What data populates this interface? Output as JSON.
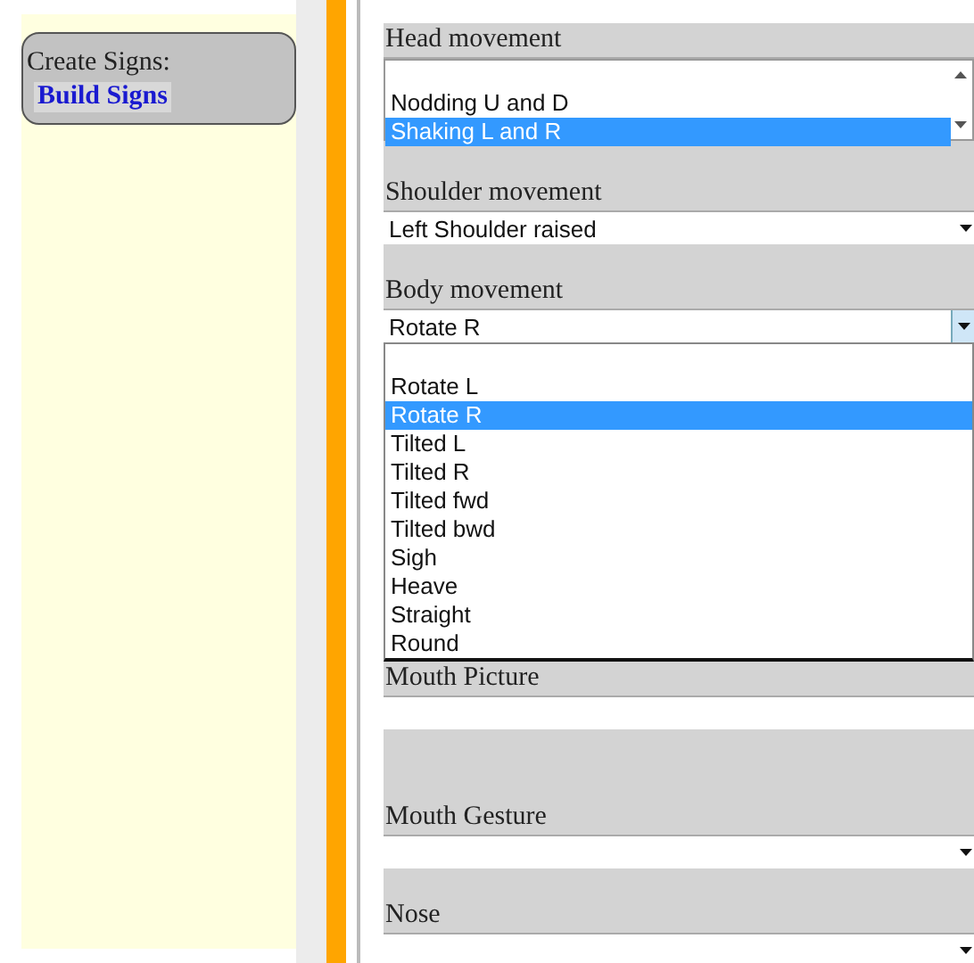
{
  "sidebar": {
    "heading": "Create Signs:",
    "link": "Build Signs"
  },
  "fields": [
    {
      "kind": "listbox",
      "label": "Head movement",
      "options": [
        {
          "text": "Nodding U and D",
          "selected": false
        },
        {
          "text": "Shaking L and R",
          "selected": true
        }
      ]
    },
    {
      "kind": "select",
      "label": "Shoulder movement",
      "value": "Left Shoulder raised"
    },
    {
      "kind": "open-select",
      "label": "Body movement",
      "value": "Rotate R",
      "options": [
        {
          "text": "Rotate L",
          "selected": false
        },
        {
          "text": "Rotate R",
          "selected": true
        },
        {
          "text": "Tilted L",
          "selected": false
        },
        {
          "text": "Tilted R",
          "selected": false
        },
        {
          "text": "Tilted fwd",
          "selected": false
        },
        {
          "text": "Tilted bwd",
          "selected": false
        },
        {
          "text": "Sigh",
          "selected": false
        },
        {
          "text": "Heave",
          "selected": false
        },
        {
          "text": "Straight",
          "selected": false
        },
        {
          "text": "Round",
          "selected": false
        }
      ]
    },
    {
      "kind": "text",
      "label": "Mouth Picture"
    },
    {
      "kind": "select",
      "label": "Mouth Gesture"
    },
    {
      "kind": "select",
      "label": "Nose"
    }
  ]
}
